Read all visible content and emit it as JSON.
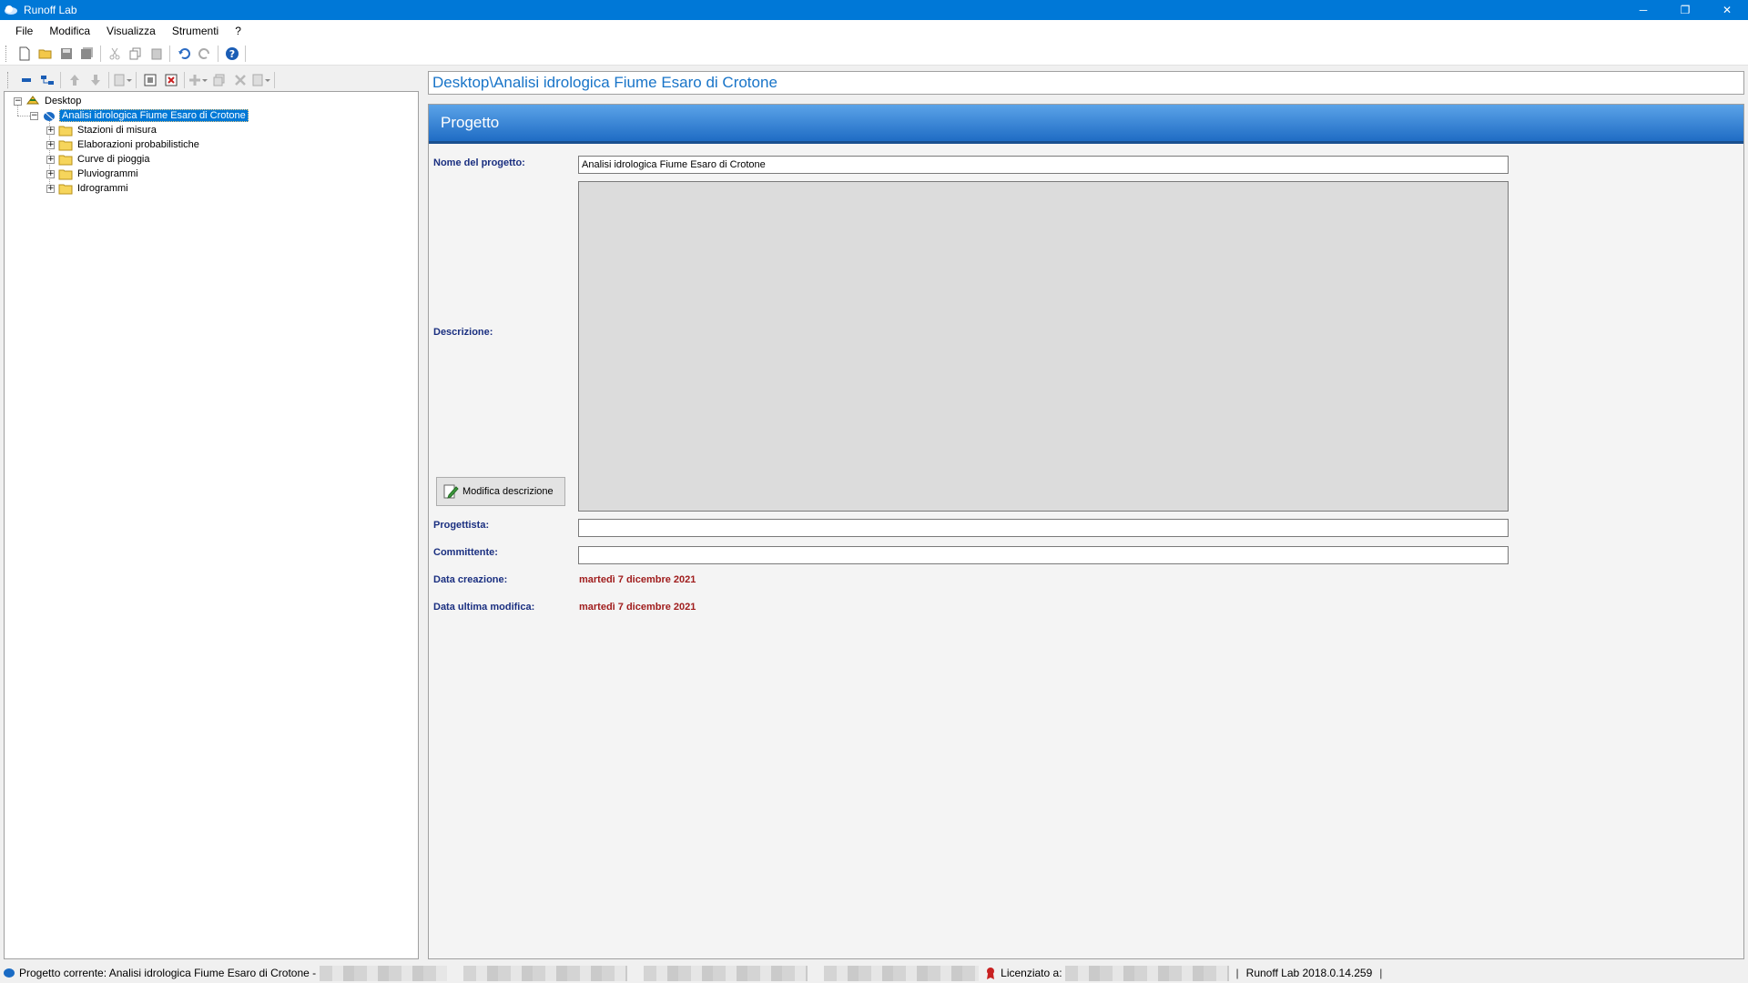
{
  "window": {
    "title": "Runoff Lab",
    "minimize": "─",
    "restore": "❐",
    "close": "✕"
  },
  "menu": [
    "File",
    "Modifica",
    "Visualizza",
    "Strumenti",
    "?"
  ],
  "tree": {
    "root": "Desktop",
    "project": "Analisi idrologica Fiume Esaro di Crotone",
    "folders": [
      "Stazioni di misura",
      "Elaborazioni probabilistiche",
      "Curve di pioggia",
      "Pluviogrammi",
      "Idrogrammi"
    ]
  },
  "path_bar": "Desktop\\Analisi idrologica Fiume Esaro di Crotone",
  "section": {
    "title": "Progetto"
  },
  "form": {
    "name_label": "Nome del progetto:",
    "name_value": "Analisi idrologica Fiume Esaro di Crotone",
    "description_label": "Descrizione:",
    "edit_description_button": "Modifica descrizione",
    "designer_label": "Progettista:",
    "designer_value": "",
    "client_label": "Committente:",
    "client_value": "",
    "created_label": "Data creazione:",
    "created_value": "martedì 7 dicembre 2021",
    "modified_label": "Data ultima modifica:",
    "modified_value": "martedì 7 dicembre 2021"
  },
  "status": {
    "current_project": "Progetto corrente: Analisi idrologica Fiume Esaro di Crotone -",
    "licensed_to": "Licenziato a:",
    "separator": "|",
    "version": "Runoff Lab 2018.0.14.259",
    "end_separator": "|"
  },
  "colors": {
    "accent": "#0078d7",
    "label_blue": "#1a2f80",
    "date_red": "#a01d1d",
    "path_blue": "#1874c8"
  }
}
